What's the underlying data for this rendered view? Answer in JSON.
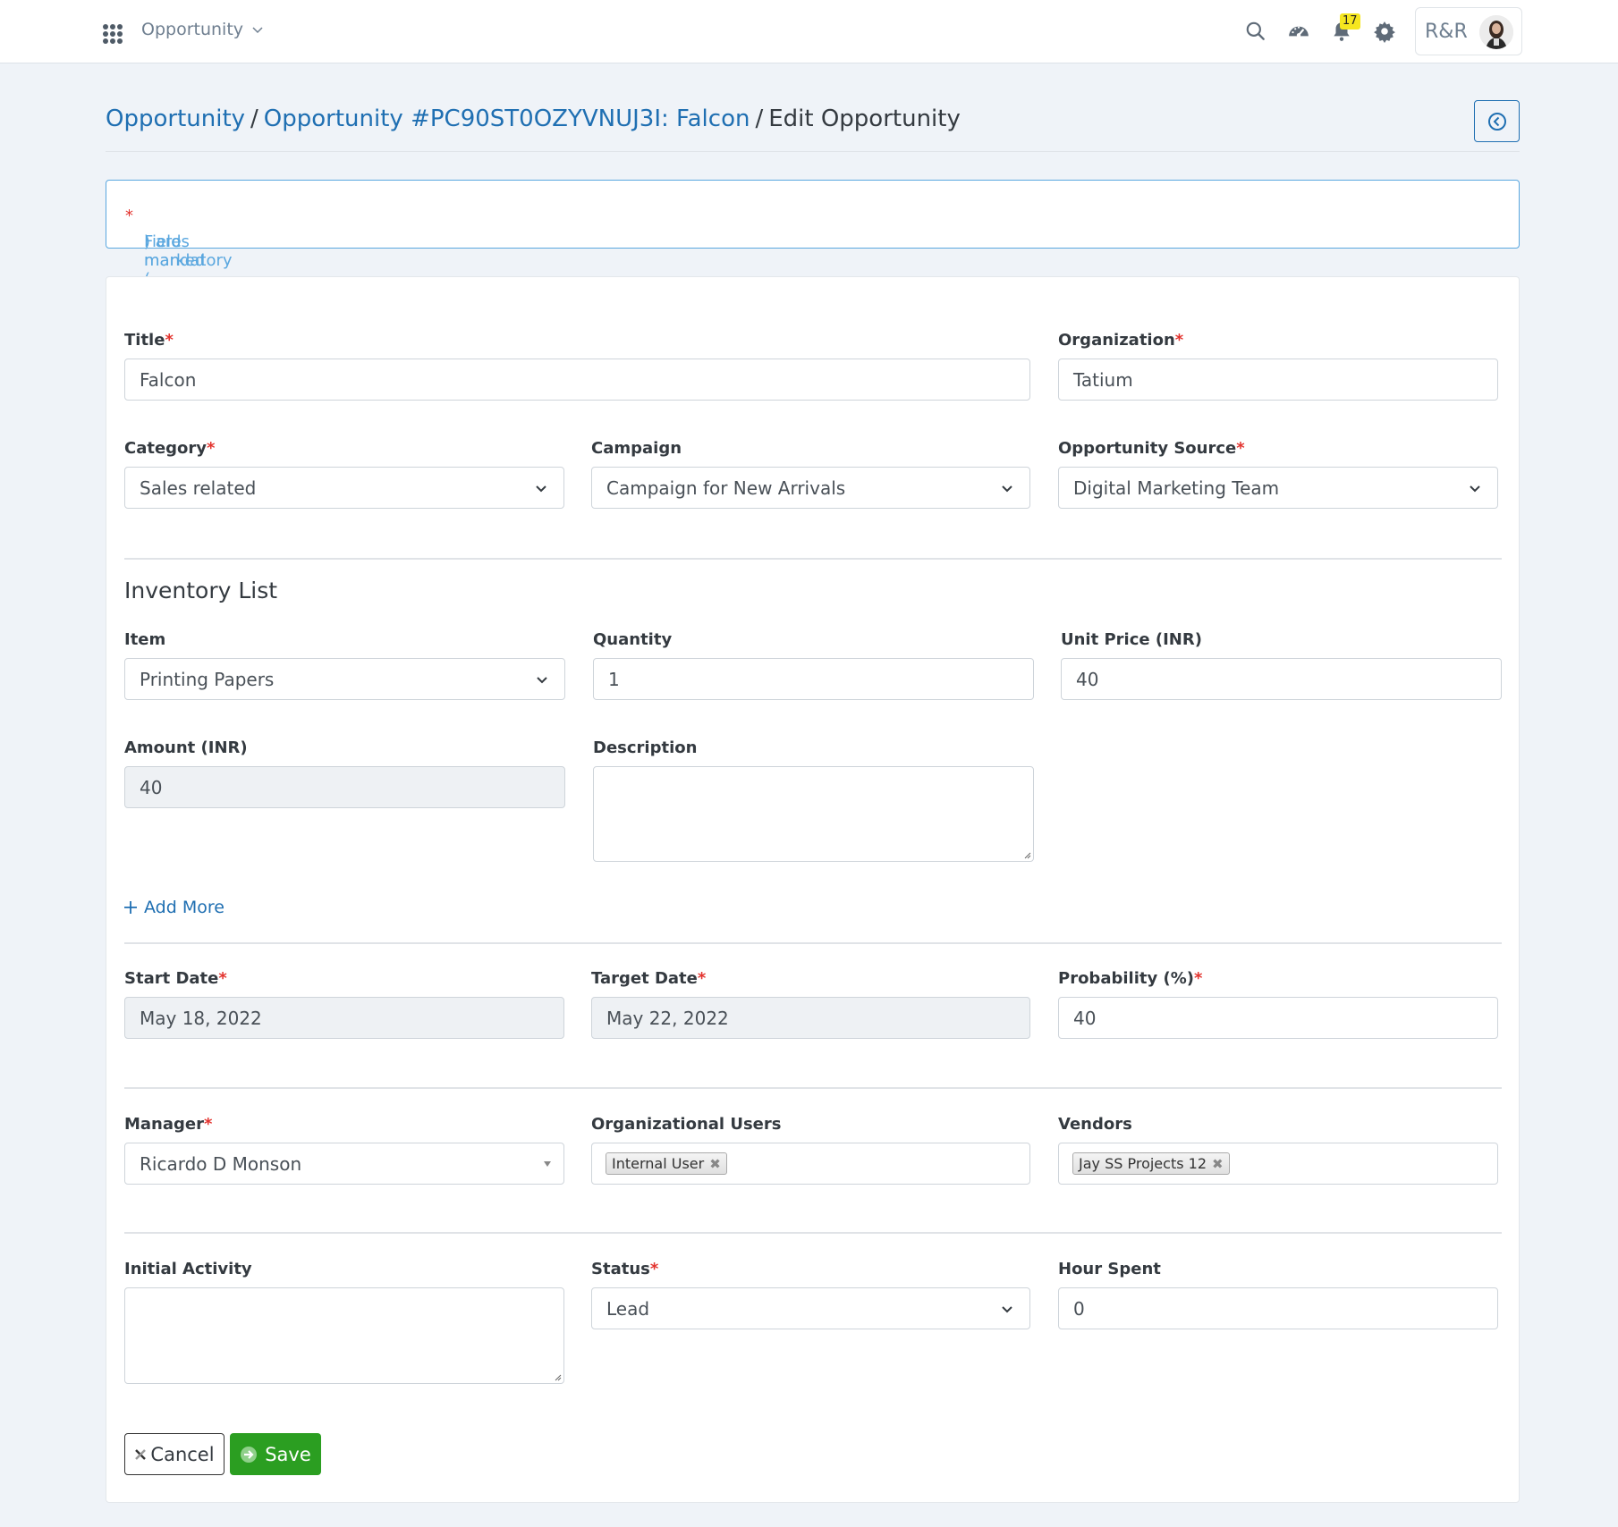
{
  "header": {
    "module": "Opportunity",
    "notification_count": "17",
    "user_initials": "R&R",
    "icons": [
      "apps-grid-icon",
      "search-icon",
      "dashboard-gauge-icon",
      "bell-icon",
      "gear-icon"
    ]
  },
  "breadcrumb": {
    "items": [
      "Opportunity",
      "Opportunity #PC90ST0OZYVNUJ3I: Falcon",
      "Edit Opportunity"
    ],
    "separator": "/"
  },
  "info": {
    "prefix": "Fields marked (",
    "star": "*",
    "suffix": ") are mandatory"
  },
  "form": {
    "title": {
      "label": "Title",
      "required": "*",
      "value": "Falcon"
    },
    "organization": {
      "label": "Organization",
      "required": "*",
      "value": "Tatium"
    },
    "category": {
      "label": "Category",
      "required": "*",
      "value": "Sales related"
    },
    "campaign": {
      "label": "Campaign",
      "value": "Campaign for New Arrivals"
    },
    "source": {
      "label": "Opportunity Source",
      "required": "*",
      "value": "Digital Marketing Team"
    },
    "inventory": {
      "heading": "Inventory List",
      "item": {
        "label": "Item",
        "value": "Printing Papers"
      },
      "quantity": {
        "label": "Quantity",
        "value": "1"
      },
      "unit_price": {
        "label": "Unit Price (INR)",
        "value": "40"
      },
      "amount": {
        "label": "Amount (INR)",
        "value": "40"
      },
      "description": {
        "label": "Description",
        "value": ""
      },
      "add_more": "Add More"
    },
    "start_date": {
      "label": "Start Date",
      "required": "*",
      "value": "May 18, 2022"
    },
    "target_date": {
      "label": "Target Date",
      "required": "*",
      "value": "May 22, 2022"
    },
    "probability": {
      "label": "Probability (%)",
      "required": "*",
      "value": "40"
    },
    "manager": {
      "label": "Manager",
      "required": "*",
      "value": "Ricardo D Monson"
    },
    "org_users": {
      "label": "Organizational Users",
      "tags": [
        "Internal User"
      ]
    },
    "vendors": {
      "label": "Vendors",
      "tags": [
        "Jay SS Projects 12"
      ]
    },
    "initial_activity": {
      "label": "Initial Activity",
      "value": ""
    },
    "status": {
      "label": "Status",
      "required": "*",
      "value": "Lead"
    },
    "hour_spent": {
      "label": "Hour Spent",
      "value": "0"
    }
  },
  "actions": {
    "cancel": "Cancel",
    "save": "Save"
  },
  "colors": {
    "link": "#1f6fb2",
    "required": "#e3342f",
    "save": "#2b9e21",
    "info": "#5aa7df",
    "badge": "#f5e61f"
  }
}
